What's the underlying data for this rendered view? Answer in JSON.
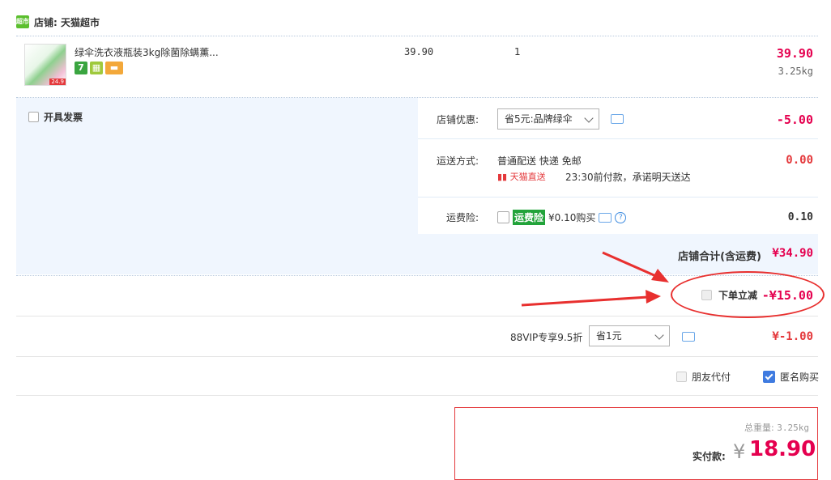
{
  "shop": {
    "label": "店铺: 天猫超市",
    "logo_text": "超市"
  },
  "item": {
    "title": "绿伞洗衣液瓶装3kg除菌除螨薰...",
    "thumb_caption": "24.9",
    "badge_7": "7",
    "unit_price": "39.90",
    "quantity": "1",
    "sum_price": "39.90",
    "weight": "3.25kg"
  },
  "invoice": {
    "label": "开具发票"
  },
  "shop_discount": {
    "label": "店铺优惠:",
    "selected": "省5元:品牌绿伞",
    "amount": "-5.00"
  },
  "delivery": {
    "label": "运送方式:",
    "method": "普通配送 快递 免邮",
    "tmall_tag": "天猫直送",
    "promise": "23:30前付款，承诺明天送达",
    "amount": "0.00"
  },
  "insurance": {
    "label": "运费险:",
    "tag": "运费险",
    "price": "¥0.10购买",
    "help": "?",
    "amount": "0.10"
  },
  "shop_total": {
    "label": "店铺合计(含运费)",
    "amount": "¥34.90"
  },
  "instant_discount": {
    "label": "下单立减",
    "amount": "-¥15.00"
  },
  "vip": {
    "label": "88VIP专享9.5折",
    "selected": "省1元",
    "amount": "¥-1.00"
  },
  "options": {
    "friend_pay": "朋友代付",
    "anonymous": "匿名购买"
  },
  "payment": {
    "weight_label": "总重量:",
    "weight_value": "3.25kg",
    "pay_label": "实付款:",
    "currency": "¥",
    "amount": "18.90"
  },
  "colors": {
    "accent_red": "#e4393c",
    "price_red": "#e5004f",
    "annotation_red": "#e8302f",
    "panel_bg": "#f0f6fe"
  }
}
